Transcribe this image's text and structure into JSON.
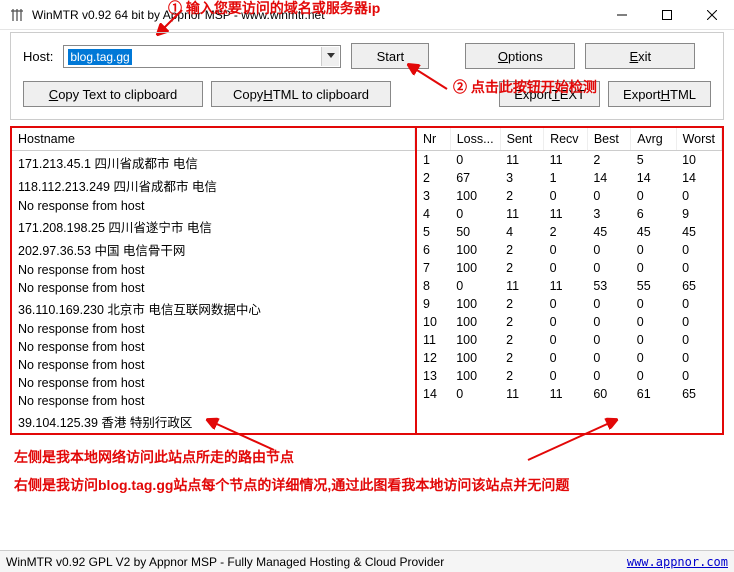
{
  "window": {
    "title": "WinMTR v0.92 64 bit by Appnor MSP - www.winmtr.net"
  },
  "top": {
    "host_label": "Host:",
    "host_value": "blog.tag.gg",
    "start": "Start",
    "options_pre": "O",
    "options_mid": "ptions",
    "exit_pre": "E",
    "exit_mid": "xit",
    "copy_text_pre": "C",
    "copy_text_mid": "opy Text to clipboard",
    "copy_html_pre": "Copy ",
    "copy_html_u": "H",
    "copy_html_post": "TML to clipboard",
    "export_text_pre": "Export ",
    "export_text_u": "T",
    "export_text_post": "EXT",
    "export_html_pre": "Export ",
    "export_html_u": "H",
    "export_html_post": "TML"
  },
  "annot": {
    "a1": "① 输入您要访问的域名或服务器ip",
    "a2": "② 点击此按钮开始检测",
    "al": "左侧是我本地网络访问此站点所走的路由节点",
    "ar": "右侧是我访问blog.tag.gg站点每个节点的详细情况,通过此图看我本地访问该站点并无问题"
  },
  "table": {
    "headers_left": [
      "Hostname"
    ],
    "headers_right": [
      "Nr",
      "Loss...",
      "Sent",
      "Recv",
      "Best",
      "Avrg",
      "Worst"
    ],
    "rows": [
      {
        "host": "171.213.45.1 四川省成都市 电信",
        "nr": 1,
        "loss": 0,
        "sent": 11,
        "recv": 11,
        "best": 2,
        "avrg": 5,
        "worst": 10
      },
      {
        "host": "118.112.213.249 四川省成都市 电信",
        "nr": 2,
        "loss": 67,
        "sent": 3,
        "recv": 1,
        "best": 14,
        "avrg": 14,
        "worst": 14
      },
      {
        "host": "No response from host",
        "nr": 3,
        "loss": 100,
        "sent": 2,
        "recv": 0,
        "best": 0,
        "avrg": 0,
        "worst": 0
      },
      {
        "host": "171.208.198.25 四川省遂宁市 电信",
        "nr": 4,
        "loss": 0,
        "sent": 11,
        "recv": 11,
        "best": 3,
        "avrg": 6,
        "worst": 9
      },
      {
        "host": "202.97.36.53 中国 电信骨干网",
        "nr": 5,
        "loss": 50,
        "sent": 4,
        "recv": 2,
        "best": 45,
        "avrg": 45,
        "worst": 45
      },
      {
        "host": "No response from host",
        "nr": 6,
        "loss": 100,
        "sent": 2,
        "recv": 0,
        "best": 0,
        "avrg": 0,
        "worst": 0
      },
      {
        "host": "No response from host",
        "nr": 7,
        "loss": 100,
        "sent": 2,
        "recv": 0,
        "best": 0,
        "avrg": 0,
        "worst": 0
      },
      {
        "host": "36.110.169.230 北京市 电信互联网数据中心",
        "nr": 8,
        "loss": 0,
        "sent": 11,
        "recv": 11,
        "best": 53,
        "avrg": 55,
        "worst": 65
      },
      {
        "host": "No response from host",
        "nr": 9,
        "loss": 100,
        "sent": 2,
        "recv": 0,
        "best": 0,
        "avrg": 0,
        "worst": 0
      },
      {
        "host": "No response from host",
        "nr": 10,
        "loss": 100,
        "sent": 2,
        "recv": 0,
        "best": 0,
        "avrg": 0,
        "worst": 0
      },
      {
        "host": "No response from host",
        "nr": 11,
        "loss": 100,
        "sent": 2,
        "recv": 0,
        "best": 0,
        "avrg": 0,
        "worst": 0
      },
      {
        "host": "No response from host",
        "nr": 12,
        "loss": 100,
        "sent": 2,
        "recv": 0,
        "best": 0,
        "avrg": 0,
        "worst": 0
      },
      {
        "host": "No response from host",
        "nr": 13,
        "loss": 100,
        "sent": 2,
        "recv": 0,
        "best": 0,
        "avrg": 0,
        "worst": 0
      },
      {
        "host": "39.104.125.39 香港 特别行政区",
        "nr": 14,
        "loss": 0,
        "sent": 11,
        "recv": 11,
        "best": 60,
        "avrg": 61,
        "worst": 65
      }
    ]
  },
  "status": {
    "text": "WinMTR v0.92 GPL V2 by Appnor MSP - Fully Managed Hosting & Cloud Provider",
    "link": "www.appnor.com"
  }
}
